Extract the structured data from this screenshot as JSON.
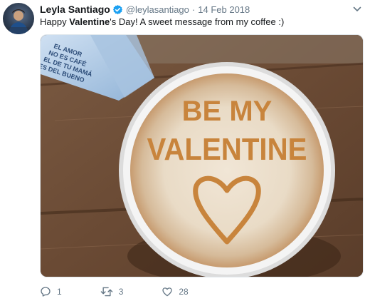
{
  "tweet": {
    "author": {
      "name": "Leyla Santiago",
      "handle": "@leylasantiago",
      "verified": true
    },
    "dot": "·",
    "date": "14 Feb 2018",
    "text": {
      "before": "Happy ",
      "bold": "Valentine",
      "after": "'s Day! A sweet message from my coffee :)"
    },
    "image": {
      "latte_text_line1": "BE MY",
      "latte_text_line2": "VALENTINE",
      "card_text_line1": "EL AMOR",
      "card_text_line2": "NO ES CAFÉ",
      "card_text_line3": "EL DE TU MAMÁ",
      "card_text_line4": "ES DEL BUENO"
    },
    "actions": {
      "replies": "1",
      "retweets": "3",
      "likes": "28"
    }
  },
  "colors": {
    "verified_blue": "#1da1f2",
    "muted_gray": "#657786",
    "text_dark": "#14171a"
  }
}
